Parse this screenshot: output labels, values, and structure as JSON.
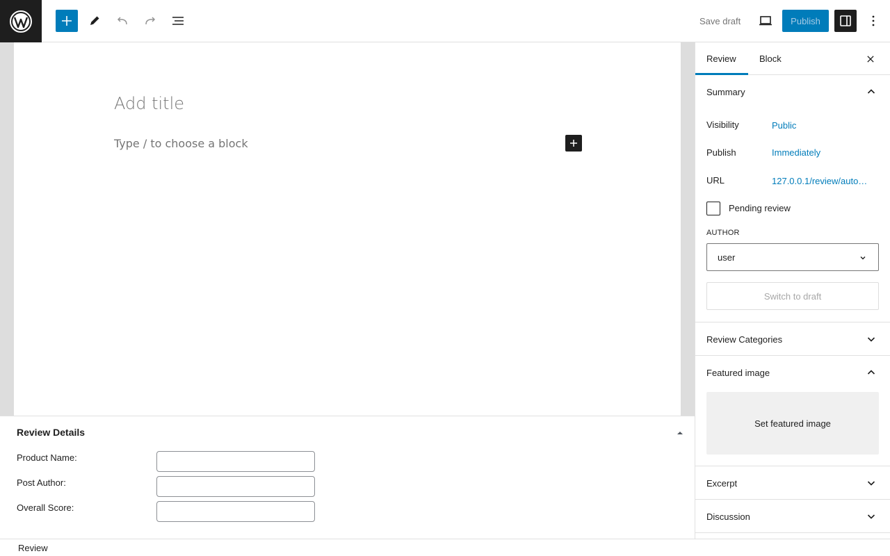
{
  "toolbar": {
    "logo_icon": "wordpress-logo-icon",
    "inserter_icon": "plus-icon",
    "tools_icon": "pencil-icon",
    "undo_icon": "undo-icon",
    "redo_icon": "redo-icon",
    "list_view_icon": "list-view-icon",
    "save_draft_label": "Save draft",
    "preview_icon": "desktop-icon",
    "publish_label": "Publish",
    "settings_icon": "sidebar-icon",
    "more_icon": "more-vertical-icon"
  },
  "editor": {
    "title_placeholder": "Add title",
    "block_placeholder": "Type / to choose a block",
    "add_block_icon": "plus-icon"
  },
  "metabox": {
    "title": "Review Details",
    "fields": [
      {
        "label": "Product Name:",
        "value": ""
      },
      {
        "label": "Post Author:",
        "value": ""
      },
      {
        "label": "Overall Score:",
        "value": ""
      }
    ]
  },
  "footer": {
    "breadcrumb": "Review"
  },
  "sidebar": {
    "tabs": [
      {
        "label": "Review",
        "active": true
      },
      {
        "label": "Block",
        "active": false
      }
    ],
    "summary": {
      "title": "Summary",
      "rows": [
        {
          "label": "Visibility",
          "value": "Public"
        },
        {
          "label": "Publish",
          "value": "Immediately"
        },
        {
          "label": "URL",
          "value": "127.0.0.1/review/auto…"
        }
      ],
      "pending_review_label": "Pending review",
      "pending_review_checked": false,
      "author_label": "AUTHOR",
      "author_value": "user",
      "switch_draft_label": "Switch to draft"
    },
    "panels": {
      "review_categories": "Review Categories",
      "featured_image": "Featured image",
      "set_featured_image": "Set featured image",
      "excerpt": "Excerpt",
      "discussion": "Discussion"
    }
  },
  "colors": {
    "accent": "#007cba",
    "dark": "#1e1e1e",
    "border": "#e0e0e0"
  }
}
